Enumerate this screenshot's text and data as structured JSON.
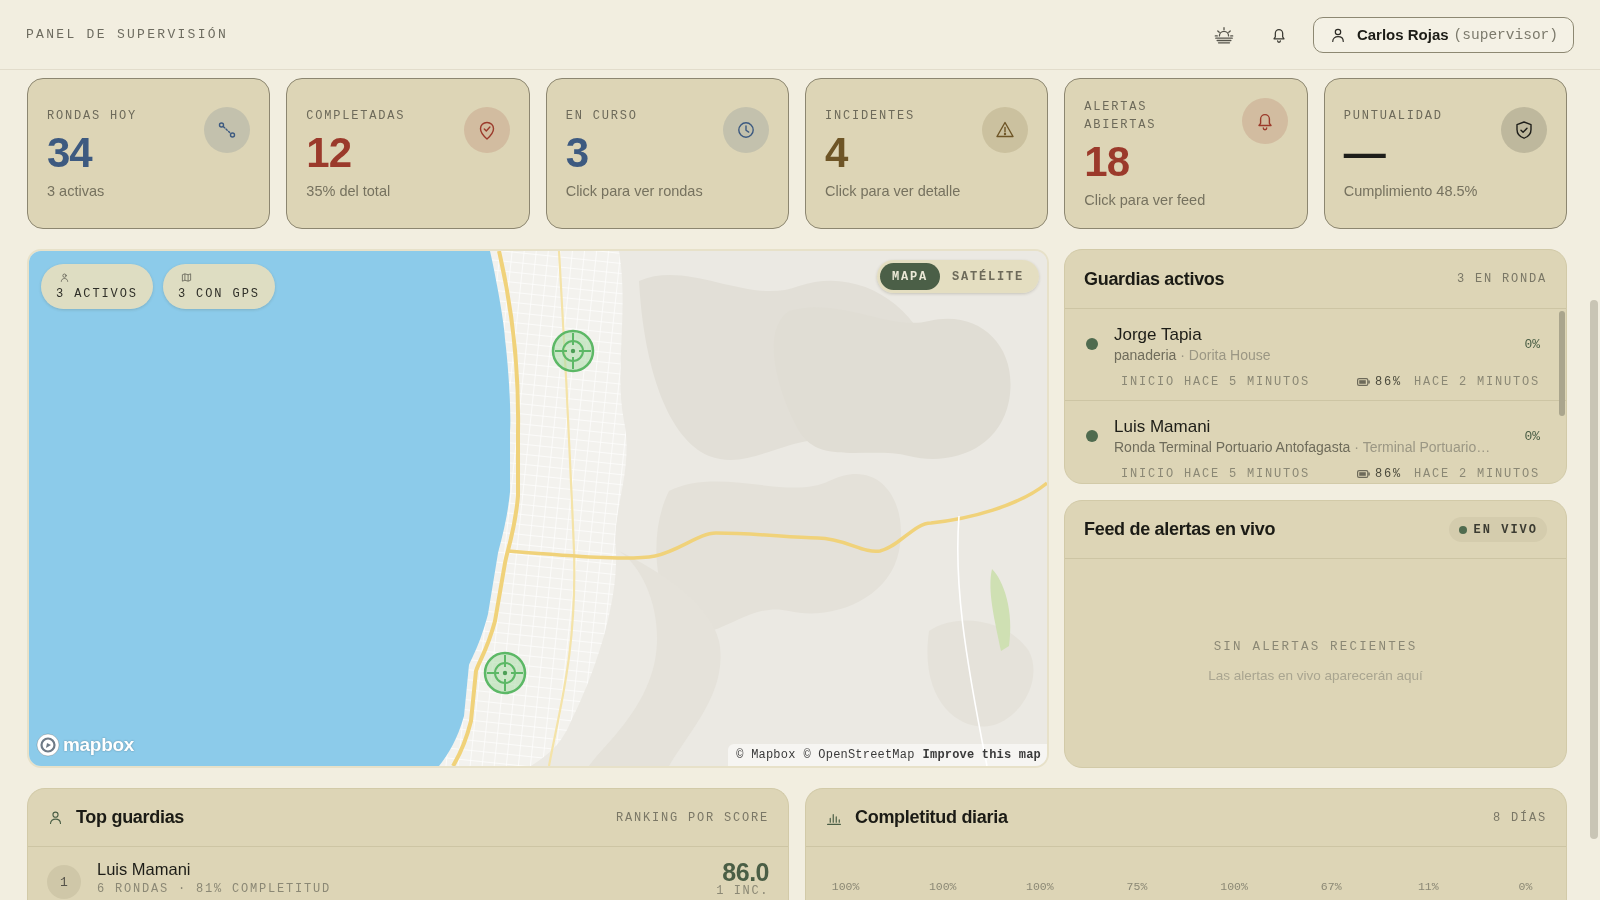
{
  "header": {
    "title": "PANEL DE SUPERVISIÓN",
    "user": {
      "name": "Carlos Rojas",
      "role": "(supervisor)"
    }
  },
  "kpis": [
    {
      "label": "RONDAS HOY",
      "value": "34",
      "note": "3 activas",
      "color": "#3d5a80"
    },
    {
      "label": "COMPLETADAS",
      "value": "12",
      "note": "35% del total",
      "color": "#9b3a2b"
    },
    {
      "label": "EN CURSO",
      "value": "3",
      "note": "Click para ver rondas",
      "color": "#3d5a80"
    },
    {
      "label": "INCIDENTES",
      "value": "4",
      "note": "Click para ver detalle",
      "color": "#6e5526"
    },
    {
      "label": "ALERTAS ABIERTAS",
      "value": "18",
      "note": "Click para ver feed",
      "color": "#9b3a2b"
    },
    {
      "label": "PUNTUALIDAD",
      "value": "—",
      "note": "Cumplimiento 48.5%",
      "color": "#1e1e1a"
    }
  ],
  "map": {
    "chips": [
      {
        "label": "3 ACTIVOS"
      },
      {
        "label": "3 CON GPS"
      }
    ],
    "view_toggle": [
      {
        "label": "MAPA",
        "selected": true
      },
      {
        "label": "SATÉLITE",
        "selected": false
      }
    ],
    "logo": "mapbox",
    "attribution": [
      {
        "label": "© Mapbox"
      },
      {
        "label": "© OpenStreetMap"
      },
      {
        "label": "Improve this map"
      }
    ]
  },
  "active_guards": {
    "title": "Guardias activos",
    "count": "3 EN RONDA",
    "items": [
      {
        "name": "Jorge Tapia",
        "online": true,
        "route": "panaderia",
        "site": "· Dorita House",
        "progress": "0%",
        "started": "INICIO HACE 5 MINUTOS",
        "battery": "86%",
        "last_seen": "HACE 2 MINUTOS"
      },
      {
        "name": "Luis Mamani",
        "online": true,
        "route": "Ronda Terminal Portuario Antofagasta",
        "site": "· Terminal Portuario…",
        "progress": "0%",
        "started": "INICIO HACE 5 MINUTOS",
        "battery": "86%",
        "last_seen": "HACE 2 MINUTOS"
      }
    ]
  },
  "alert_feed": {
    "title": "Feed de alertas en vivo",
    "badge": "EN VIVO",
    "empty_title": "SIN ALERTAS RECIENTES",
    "empty_text": "Las alertas en vivo aparecerán aquí"
  },
  "top_guards": {
    "title": "Top guardias",
    "subtitle": "RANKING POR SCORE",
    "items": [
      {
        "rank": "1",
        "name": "Luis Mamani",
        "detail": "6 RONDAS · 81% COMPLETITUD",
        "score": "86.0",
        "incidents": "1 INC."
      }
    ]
  },
  "daily_completion": {
    "title": "Completitud diaria",
    "subtitle": "8 DÍAS",
    "labels": [
      "100%",
      "100%",
      "100%",
      "75%",
      "100%",
      "67%",
      "11%",
      "0%"
    ]
  }
}
